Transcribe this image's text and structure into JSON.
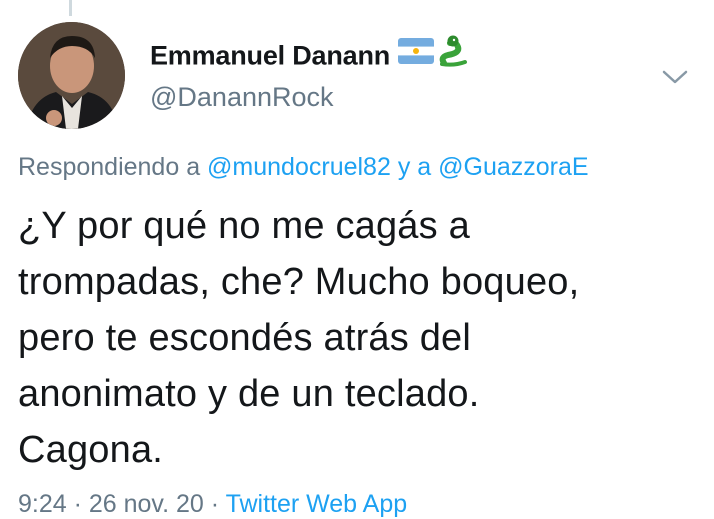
{
  "author": {
    "display_name": "Emmanuel Danann",
    "handle": "@DanannRock"
  },
  "reply": {
    "prefix": "Respondiendo a",
    "user1": "@mundocruel82",
    "connector": "y a",
    "user2": "@GuazzoraE"
  },
  "tweet": {
    "lines": [
      "¿Y por qué no me cagás a",
      "trompadas, che? Mucho boqueo,",
      "pero te escondés atrás del",
      "anonimato y de un teclado.",
      "Cagona."
    ]
  },
  "meta": {
    "time": "9:24 · 26 nov. 20",
    "source": "Twitter Web App"
  },
  "icons": {
    "flag": "argentina-flag-icon",
    "snake": "snake-icon",
    "menu": "chevron-down-icon"
  },
  "colors": {
    "text": "#14171a",
    "secondary": "#657786",
    "link": "#1da1f2"
  }
}
